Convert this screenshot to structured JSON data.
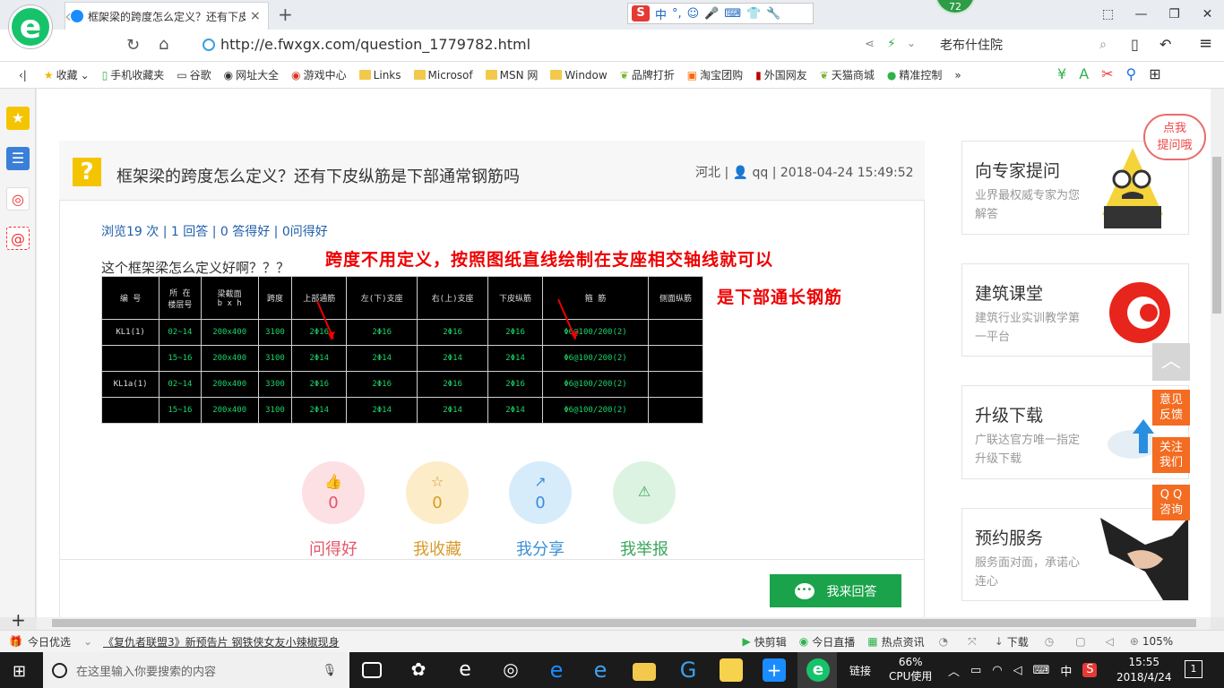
{
  "browser": {
    "tab_title": "框架梁的跨度怎么定义？还有下皮",
    "tab_close": "×",
    "new_tab": "+",
    "url": "http://e.fwxgx.com/question_1779782.html",
    "badge_count": "72",
    "search_text": "老布什住院",
    "ime": {
      "lang": "中",
      "dot": "°,"
    },
    "window_controls": [
      "⬚",
      "—",
      "❐",
      "✕"
    ]
  },
  "bookmarks": [
    "收藏",
    "手机收藏夹",
    "谷歌",
    "网址大全",
    "游戏中心",
    "Links",
    "Microsof",
    "MSN 网",
    "Window",
    "品牌打折",
    "淘宝团购",
    "外国网友",
    "天猫商城",
    "精准控制"
  ],
  "bookmarks_more": "»",
  "question": {
    "title": "框架梁的跨度怎么定义？还有下皮纵筋是下部通常钢筋吗",
    "meta": "河北 | 👤 qq | 2018-04-24 15:49:52",
    "stats": "浏览19 次 | 1 回答 | 0 答得好 | 0问得好",
    "body": "这个框架梁怎么定义好啊？？？",
    "annotation1": "跨度不用定义，按照图纸直线绘制在支座相交轴线就可以",
    "annotation2": "是下部通长钢筋"
  },
  "cad_table": {
    "headers": [
      "编 号",
      "所 在\n楼层号",
      "梁截面\nb x h",
      "跨度",
      "上部通筋",
      "左(下)支座",
      "右(上)支座",
      "下皮纵筋",
      "箍 筋",
      "侧面纵筋"
    ],
    "rows": [
      [
        "KL1(1)",
        "02~14",
        "200x400",
        "3100",
        "2Φ16",
        "2Φ16",
        "2Φ16",
        "2Φ16",
        "Φ6@100/200(2)",
        ""
      ],
      [
        "",
        "15~16",
        "200x400",
        "3100",
        "2Φ14",
        "2Φ14",
        "2Φ14",
        "2Φ14",
        "Φ6@100/200(2)",
        ""
      ],
      [
        "KL1a(1)",
        "02~14",
        "200x400",
        "3300",
        "2Φ16",
        "2Φ16",
        "2Φ16",
        "2Φ16",
        "Φ6@100/200(2)",
        ""
      ],
      [
        "",
        "15~16",
        "200x400",
        "3100",
        "2Φ14",
        "2Φ14",
        "2Φ14",
        "2Φ14",
        "Φ6@100/200(2)",
        ""
      ]
    ]
  },
  "actions": [
    {
      "count": "0",
      "label": "问得好",
      "icon": "thumbs-up-icon",
      "color": "#e3566a",
      "bg": "#fde0e4",
      "glyph": "👍"
    },
    {
      "count": "0",
      "label": "我收藏",
      "icon": "star-icon",
      "color": "#d89a2a",
      "bg": "#fdecc8",
      "glyph": "☆"
    },
    {
      "count": "0",
      "label": "我分享",
      "icon": "share-icon",
      "color": "#3a8fd8",
      "bg": "#d7ecfb",
      "glyph": "↗"
    },
    {
      "count": "",
      "label": "我举报",
      "icon": "warning-icon",
      "color": "#3aa65c",
      "bg": "#dcf3e2",
      "glyph": "⚠"
    }
  ],
  "answer_button": "我来回答",
  "ads": [
    {
      "title": "向专家提问",
      "desc": "业界最权威专家为您解答"
    },
    {
      "title": "建筑课堂",
      "desc": "建筑行业实训教学第一平台"
    },
    {
      "title": "升级下载",
      "desc": "广联达官方唯一指定升级下载"
    },
    {
      "title": "预约服务",
      "desc": "服务面对面，承诺心连心"
    }
  ],
  "bubble": "点我\n提问哦",
  "float_buttons": [
    "意见\n反馈",
    "关注\n我们",
    "Q Q\n咨询"
  ],
  "statusbar": {
    "today": "今日优选",
    "news": "《复仇者联盟3》新预告片 钢铁侠女友小辣椒现身",
    "kuaijian": "快剪辑",
    "live": "今日直播",
    "hot": "热点资讯",
    "download": "下载",
    "zoom": "105%"
  },
  "taskbar": {
    "search_placeholder": "在这里输入你要搜索的内容",
    "link": "链接",
    "cpu_pct": "66%",
    "cpu_label": "CPU使用",
    "lang": "中",
    "time": "15:55",
    "date": "2018/4/24",
    "notif": "1"
  }
}
